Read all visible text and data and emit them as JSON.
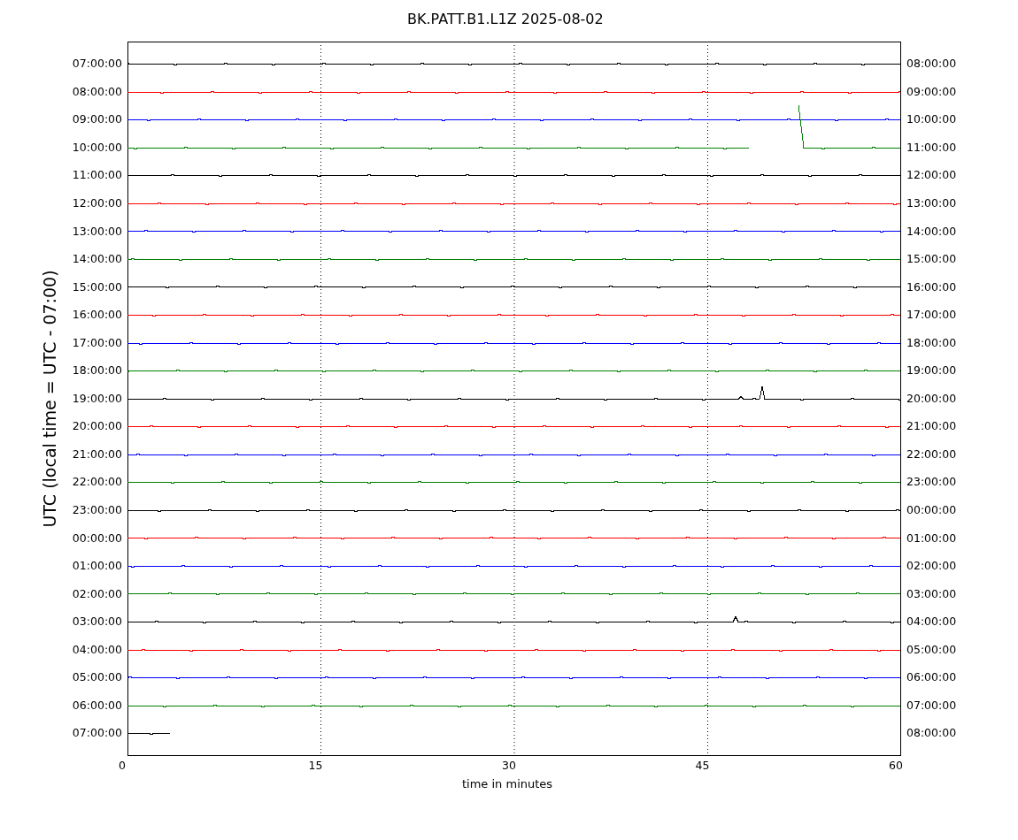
{
  "title": "BK.PATT.B1.L1Z 2025-08-02",
  "ylabel": "UTC (local time = UTC - 07:00)",
  "xlabel": "time in minutes",
  "xticks": [
    "0",
    "15",
    "30",
    "45",
    "60"
  ],
  "rows": [
    {
      "left": "07:00:00",
      "right": "08:00:00",
      "color": "#000000",
      "level": 1
    },
    {
      "left": "08:00:00",
      "right": "09:00:00",
      "color": "#ff0000",
      "level": 1
    },
    {
      "left": "09:00:00",
      "right": "10:00:00",
      "color": "#0000ff",
      "level": 1
    },
    {
      "left": "10:00:00",
      "right": "11:00:00",
      "color": "#008000",
      "level": 1
    },
    {
      "left": "11:00:00",
      "right": "12:00:00",
      "color": "#000000",
      "level": 1
    },
    {
      "left": "12:00:00",
      "right": "13:00:00",
      "color": "#ff0000",
      "level": 1
    },
    {
      "left": "13:00:00",
      "right": "14:00:00",
      "color": "#0000ff",
      "level": 1
    },
    {
      "left": "14:00:00",
      "right": "15:00:00",
      "color": "#008000",
      "level": 1
    },
    {
      "left": "15:00:00",
      "right": "16:00:00",
      "color": "#000000",
      "level": 1
    },
    {
      "left": "16:00:00",
      "right": "17:00:00",
      "color": "#ff0000",
      "level": 1
    },
    {
      "left": "17:00:00",
      "right": "18:00:00",
      "color": "#0000ff",
      "level": 1
    },
    {
      "left": "18:00:00",
      "right": "19:00:00",
      "color": "#008000",
      "level": 1
    },
    {
      "left": "19:00:00",
      "right": "20:00:00",
      "color": "#000000",
      "level": 1
    },
    {
      "left": "20:00:00",
      "right": "21:00:00",
      "color": "#ff0000",
      "level": 1
    },
    {
      "left": "21:00:00",
      "right": "22:00:00",
      "color": "#0000ff",
      "level": 1
    },
    {
      "left": "22:00:00",
      "right": "23:00:00",
      "color": "#008000",
      "level": 1
    },
    {
      "left": "23:00:00",
      "right": "00:00:00",
      "color": "#000000",
      "level": 1
    },
    {
      "left": "00:00:00",
      "right": "01:00:00",
      "color": "#ff0000",
      "level": 1
    },
    {
      "left": "01:00:00",
      "right": "02:00:00",
      "color": "#0000ff",
      "level": 1
    },
    {
      "left": "02:00:00",
      "right": "03:00:00",
      "color": "#008000",
      "level": 1
    },
    {
      "left": "03:00:00",
      "right": "04:00:00",
      "color": "#000000",
      "level": 1
    },
    {
      "left": "04:00:00",
      "right": "05:00:00",
      "color": "#ff0000",
      "level": 1
    },
    {
      "left": "05:00:00",
      "right": "06:00:00",
      "color": "#0000ff",
      "level": 1
    },
    {
      "left": "06:00:00",
      "right": "07:00:00",
      "color": "#008000",
      "level": 1
    },
    {
      "left": "07:00:00",
      "right": "08:00:00",
      "color": "#000000",
      "level": 0.055
    }
  ]
}
